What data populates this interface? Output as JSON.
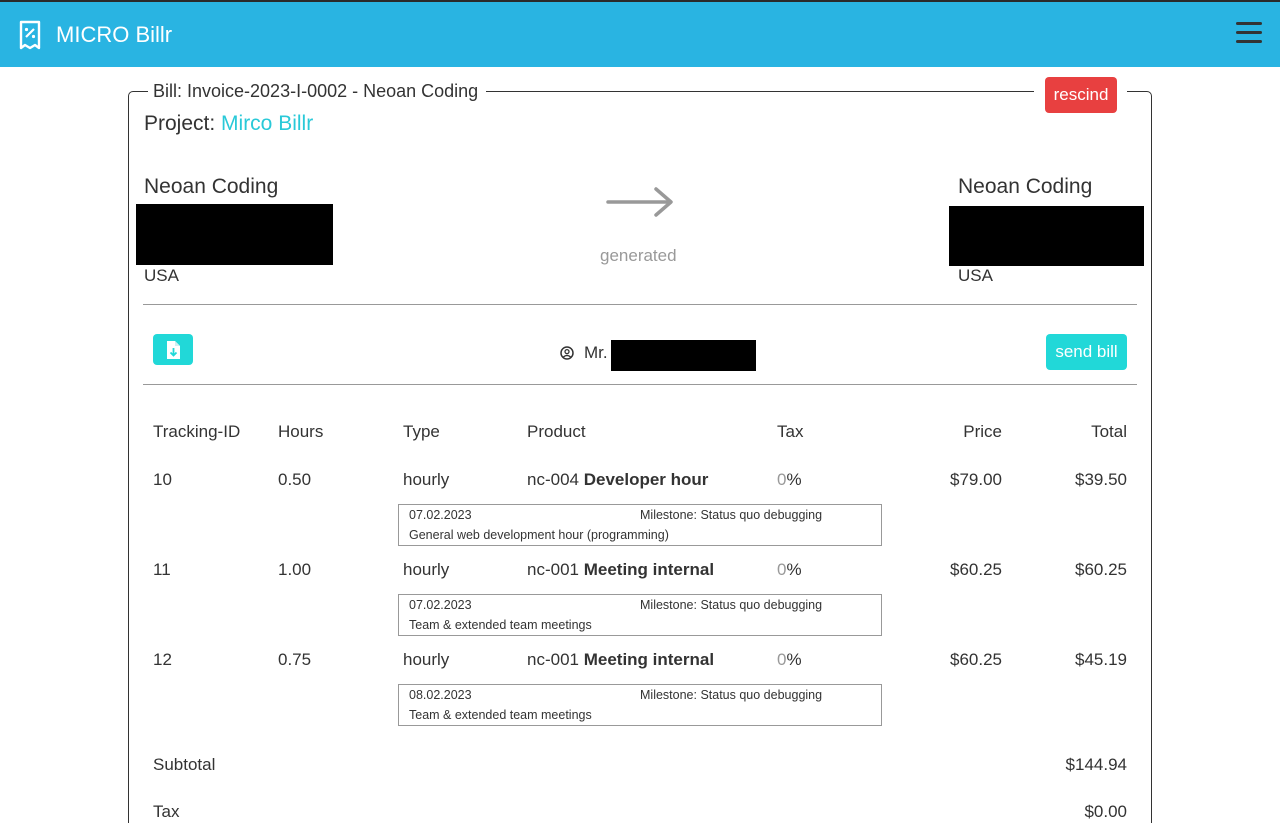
{
  "app": {
    "name": "MICRO Billr",
    "logo_icon": "receipt-percent-icon",
    "menu_icon": "hamburger-menu-icon"
  },
  "bill": {
    "legend": "Bill: Invoice-2023-I-0002 - Neoan Coding",
    "rescind_label": "rescind",
    "project_label": "Project: ",
    "project_name": "Mirco Billr",
    "from": {
      "name": "Neoan Coding",
      "country": "USA"
    },
    "to": {
      "name": "Neoan Coding",
      "country": "USA"
    },
    "status_text": "generated",
    "status_icon": "arrow-right-icon",
    "contact_prefix": "Mr.",
    "contact_icon": "user-circle-icon",
    "pdf_icon": "file-download-icon",
    "send_label": "send bill"
  },
  "table": {
    "headers": {
      "tracking": "Tracking-ID",
      "hours": "Hours",
      "type": "Type",
      "product": "Product",
      "tax": "Tax",
      "price": "Price",
      "total": "Total"
    },
    "rows": [
      {
        "id": "10",
        "hours": "0.50",
        "type": "hourly",
        "code": "nc-004",
        "product": "Developer hour",
        "tax_value": "0",
        "tax_unit": "%",
        "price": "$79.00",
        "total": "$39.50",
        "date": "07.02.2023",
        "milestone": "Milestone: Status quo debugging",
        "description": "General web development hour (programming)"
      },
      {
        "id": "11",
        "hours": "1.00",
        "type": "hourly",
        "code": "nc-001",
        "product": "Meeting internal",
        "tax_value": "0",
        "tax_unit": "%",
        "price": "$60.25",
        "total": "$60.25",
        "date": "07.02.2023",
        "milestone": "Milestone: Status quo debugging",
        "description": "Team & extended team meetings"
      },
      {
        "id": "12",
        "hours": "0.75",
        "type": "hourly",
        "code": "nc-001",
        "product": "Meeting internal",
        "tax_value": "0",
        "tax_unit": "%",
        "price": "$60.25",
        "total": "$45.19",
        "date": "08.02.2023",
        "milestone": "Milestone: Status quo debugging",
        "description": "Team & extended team meetings"
      }
    ],
    "subtotal_label": "Subtotal",
    "subtotal_value": "$144.94",
    "tax_label": "Tax",
    "tax_value": "$0.00"
  },
  "colors": {
    "header": "#29b4e2",
    "accent": "#21d8d8",
    "danger": "#e84040",
    "link": "#29c9d8"
  }
}
